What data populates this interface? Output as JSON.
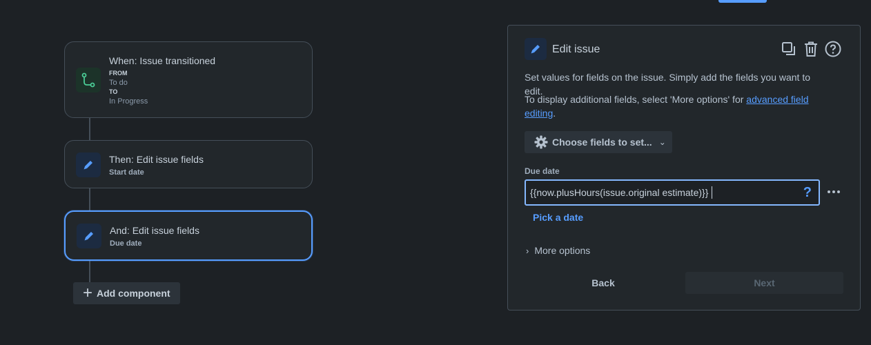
{
  "flow": {
    "trigger": {
      "title": "When: Issue transitioned",
      "from_label": "FROM",
      "from_value": "To do",
      "to_label": "TO",
      "to_value": "In Progress",
      "icon": "branch-icon"
    },
    "action1": {
      "title": "Then: Edit issue fields",
      "subtitle": "Start date",
      "icon": "pencil-icon"
    },
    "action2": {
      "title": "And: Edit issue fields",
      "subtitle": "Due date",
      "icon": "pencil-icon"
    },
    "add_component_label": "Add component"
  },
  "panel": {
    "title": "Edit issue",
    "description": "Set values for fields on the issue. Simply add the fields you want to edit.",
    "more_info_prefix": "To display additional fields, select 'More options' for ",
    "more_info_link": "advanced field editing",
    "more_info_suffix": ".",
    "choose_fields_label": "Choose fields to set...",
    "field_label": "Due date",
    "field_value": "{{now.plusHours(issue.original estimate)}}",
    "help_symbol": "?",
    "pick_date_label": "Pick a date",
    "more_options_label": "More options",
    "back_label": "Back",
    "next_label": "Next"
  },
  "colors": {
    "accent": "#579dff",
    "background": "#1d2125",
    "surface": "#22272b",
    "success_icon": "#4bce97"
  }
}
